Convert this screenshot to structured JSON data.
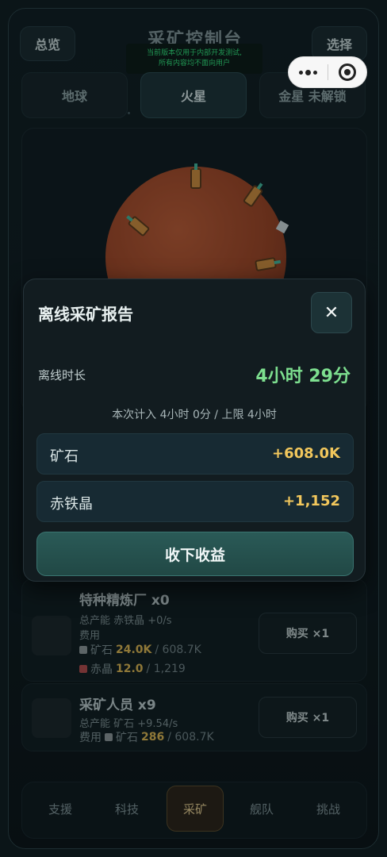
{
  "header": {
    "overview_label": "总览",
    "title": "采矿控制台",
    "select_label": "选择",
    "dev_notice_line1": "当前版本仅用于内部开发测试,",
    "dev_notice_line2": "所有内容均不面向用户"
  },
  "planet_tabs": [
    {
      "label": "地球"
    },
    {
      "label": "火星"
    },
    {
      "label": "金星 未解锁"
    }
  ],
  "items": [
    {
      "name": "特种精炼厂 x0",
      "rate": "总产能 赤铁晶 +0/s",
      "fee_label": "费用",
      "cost1_name": "矿石",
      "cost1_need": "24.0K",
      "cost1_have": "/ 608.7K",
      "cost2_name": "赤晶",
      "cost2_need": "12.0",
      "cost2_have": "/ 1,219",
      "buy_label": "购买 ×1"
    },
    {
      "name": "采矿人员 x9",
      "rate": "总产能 矿石 +9.54/s",
      "fee_label": "费用",
      "cost1_name": "矿石",
      "cost1_need": "286",
      "cost1_have": "/ 608.7K",
      "buy_label": "购买 ×1"
    }
  ],
  "nav": [
    {
      "label": "支援"
    },
    {
      "label": "科技"
    },
    {
      "label": "采矿"
    },
    {
      "label": "舰队"
    },
    {
      "label": "挑战"
    }
  ],
  "modal": {
    "title": "离线采矿报告",
    "close_symbol": "✕",
    "duration_label": "离线时长",
    "duration_value": "4小时 29分",
    "note": "本次计入 4小时 0分 / 上限 4小时",
    "rewards": [
      {
        "label": "矿石",
        "value": "+608.0K"
      },
      {
        "label": "赤铁晶",
        "value": "+1,152"
      }
    ],
    "collect_label": "收下收益"
  },
  "colors": {
    "accent_green": "#7ddf8f",
    "reward_gold": "#f2c75c",
    "active_tab_gold": "#e0c98e"
  }
}
